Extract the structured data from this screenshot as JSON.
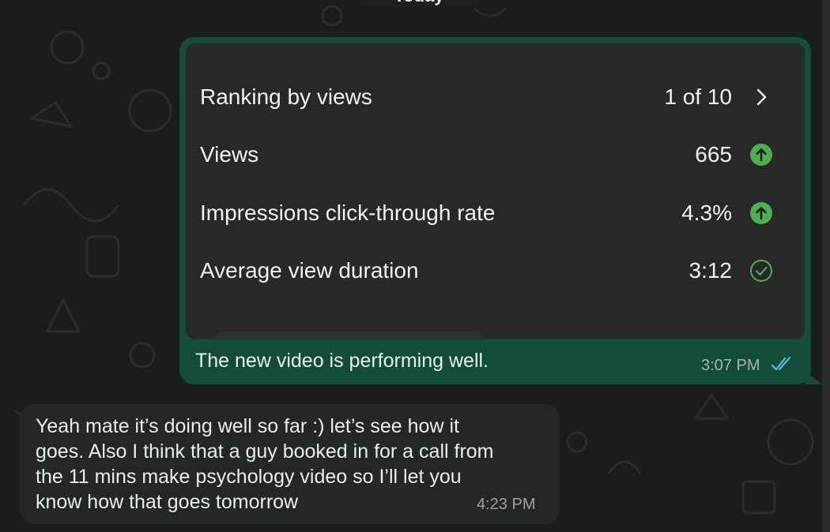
{
  "chat": {
    "date_divider": "Today",
    "outgoing": {
      "card": {
        "rows": [
          {
            "label": "Ranking by views",
            "value": "1 of 10",
            "icon": "chevron-right-icon"
          },
          {
            "label": "Views",
            "value": "665",
            "icon": "arrow-up-circle-icon"
          },
          {
            "label": "Impressions click-through rate",
            "value": "4.3%",
            "icon": "arrow-up-circle-icon"
          },
          {
            "label": "Average view duration",
            "value": "3:12",
            "icon": "check-circle-icon"
          }
        ]
      },
      "caption": "The new video is performing well.",
      "time": "3:07 PM",
      "status_icon": "double-check-read-icon"
    },
    "incoming": {
      "text": "Yeah mate it’s doing well so far :) let’s see how it\ngoes. Also I think that a guy booked in for a call from\nthe 11 mins make psychology video so I’ll let you\nknow how that goes tomorrow",
      "time": "4:23 PM"
    }
  },
  "colors": {
    "background": "#1b1d1c",
    "outgoing_bubble": "#144d37",
    "incoming_bubble": "#252726",
    "card": "#282828",
    "positive_green": "#4caf50",
    "read_tick_blue": "#53bdeb"
  }
}
